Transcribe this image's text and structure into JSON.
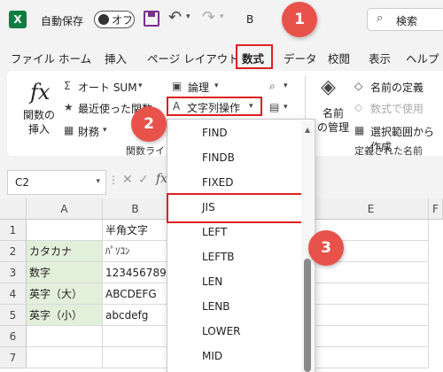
{
  "titlebar": {
    "app_icon": "X",
    "autosave_label": "自動保存",
    "autosave_toggle": "オフ",
    "title_fragment": "B",
    "search_label": "検索"
  },
  "tabs": [
    "ファイル",
    "ホーム",
    "挿入",
    "ページ レイアウト",
    "数式",
    "データ",
    "校閲",
    "表示",
    "ヘルプ"
  ],
  "active_tab": "数式",
  "ribbon": {
    "insert_function": "関数の\n挿入",
    "fx": "fx",
    "autosum": "オート SUM",
    "recent": "最近使った関数",
    "finance": "財務",
    "logical": "論理",
    "text_ops": "文字列操作",
    "group_label_fn": "関数ライ",
    "name_manager": "名前\nの管理",
    "define_name": "名前の定義",
    "use_in_formula": "数式で使用",
    "create_from_sel": "選択範囲から作成",
    "group_label_names": "定義された名前"
  },
  "namebox": {
    "value": "C2"
  },
  "formula_bar": {
    "fx": "fx"
  },
  "grid": {
    "columns": [
      "A",
      "B",
      "E",
      "F"
    ],
    "rows": [
      "1",
      "2",
      "3",
      "4",
      "5",
      "6",
      "7"
    ],
    "cells": {
      "b1": "半角文字",
      "a2": "カタカナ",
      "b2": "ﾊﾟｿｺﾝ",
      "a3": "数字",
      "b3": "123456789",
      "a4": "英字（大）",
      "b4": "ABCDEFG",
      "a5": "英字（小）",
      "b5": "abcdefg"
    }
  },
  "dropdown": {
    "items": [
      "FIND",
      "FINDB",
      "FIXED",
      "JIS",
      "LEFT",
      "LEFTB",
      "LEN",
      "LENB",
      "LOWER",
      "MID"
    ],
    "selected": "JIS"
  },
  "callouts": [
    "1",
    "2",
    "3"
  ],
  "colors": {
    "accent_red": "#e02020",
    "callout": "#e8524a",
    "excel_green": "#107c41",
    "cell_green": "#e2efda"
  }
}
